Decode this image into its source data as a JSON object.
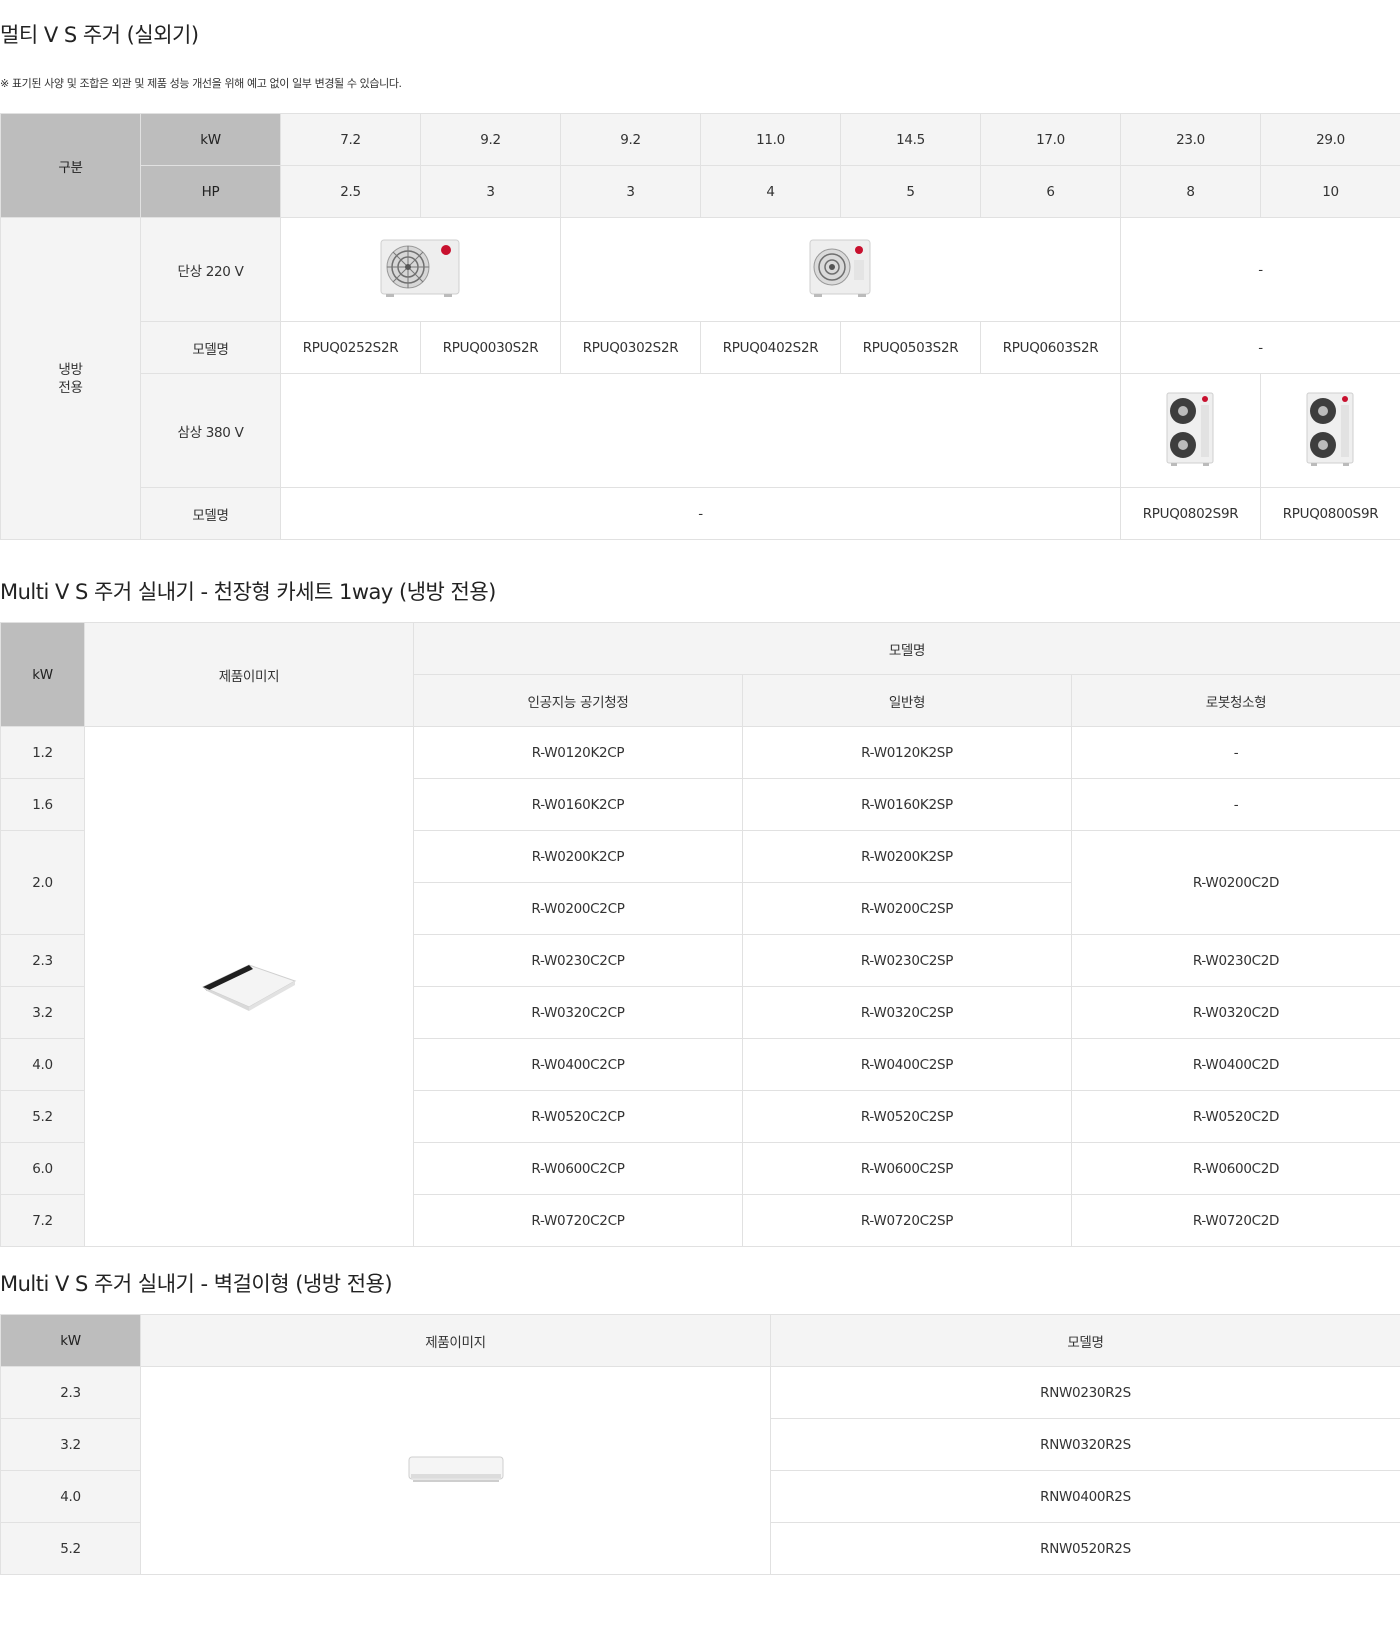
{
  "section1": {
    "title": "멀티 V S 주거 (실외기)",
    "note": "※ 표기된 사양 및 조합은 외관 및 제품 성능 개선을 위해 예고 없이 일부 변경될 수 있습니다.",
    "header": {
      "group": "구분",
      "kw_label": "kW",
      "hp_label": "HP",
      "kw": [
        "7.2",
        "9.2",
        "9.2",
        "11.0",
        "14.5",
        "17.0",
        "23.0",
        "29.0"
      ],
      "hp": [
        "2.5",
        "3",
        "3",
        "4",
        "5",
        "6",
        "8",
        "10"
      ]
    },
    "body": {
      "group": "냉방\n전용",
      "single_phase": {
        "label": "단상 220 V",
        "empty": "-",
        "model_label": "모델명",
        "models": [
          "RPUQ0252S2R",
          "RPUQ0030S2R",
          "RPUQ0302S2R",
          "RPUQ0402S2R",
          "RPUQ0503S2R",
          "RPUQ0603S2R"
        ],
        "model_empty": "-"
      },
      "three_phase": {
        "label": "삼상 380 V",
        "model_label": "모델명",
        "model_empty": "-",
        "models": [
          "RPUQ0802S9R",
          "RPUQ0800S9R"
        ]
      }
    }
  },
  "section2": {
    "title": "Multi V S 주거 실내기 - 천장형 카세트 1way (냉방 전용)",
    "header": {
      "kw": "kW",
      "image": "제품이미지",
      "model": "모델명",
      "cols": [
        "인공지능 공기청정",
        "일반형",
        "로봇청소형"
      ]
    },
    "rows": [
      {
        "kw": "1.2",
        "ai": "R-W0120K2CP",
        "std": "R-W0120K2SP",
        "robot": "-"
      },
      {
        "kw": "1.6",
        "ai": "R-W0160K2CP",
        "std": "R-W0160K2SP",
        "robot": "-"
      }
    ],
    "row20": {
      "kw": "2.0",
      "ai_a": "R-W0200K2CP",
      "std_a": "R-W0200K2SP",
      "ai_b": "R-W0200C2CP",
      "std_b": "R-W0200C2SP",
      "robot": "R-W0200C2D"
    },
    "rows2": [
      {
        "kw": "2.3",
        "ai": "R-W0230C2CP",
        "std": "R-W0230C2SP",
        "robot": "R-W0230C2D"
      },
      {
        "kw": "3.2",
        "ai": "R-W0320C2CP",
        "std": "R-W0320C2SP",
        "robot": "R-W0320C2D"
      },
      {
        "kw": "4.0",
        "ai": "R-W0400C2CP",
        "std": "R-W0400C2SP",
        "robot": "R-W0400C2D"
      },
      {
        "kw": "5.2",
        "ai": "R-W0520C2CP",
        "std": "R-W0520C2SP",
        "robot": "R-W0520C2D"
      },
      {
        "kw": "6.0",
        "ai": "R-W0600C2CP",
        "std": "R-W0600C2SP",
        "robot": "R-W0600C2D"
      },
      {
        "kw": "7.2",
        "ai": "R-W0720C2CP",
        "std": "R-W0720C2SP",
        "robot": "R-W0720C2D"
      }
    ]
  },
  "section3": {
    "title": "Multi V S 주거 실내기 - 벽걸이형 (냉방 전용)",
    "header": {
      "kw": "kW",
      "image": "제품이미지",
      "model": "모델명"
    },
    "rows": [
      {
        "kw": "2.3",
        "model": "RNW0230R2S"
      },
      {
        "kw": "3.2",
        "model": "RNW0320R2S"
      },
      {
        "kw": "4.0",
        "model": "RNW0400R2S"
      },
      {
        "kw": "5.2",
        "model": "RNW0520R2S"
      }
    ]
  }
}
